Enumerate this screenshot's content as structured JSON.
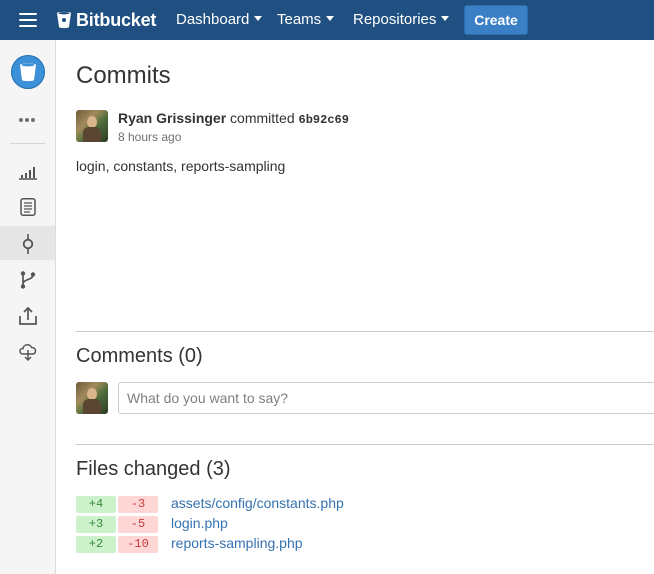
{
  "nav": {
    "brand": "Bitbucket",
    "dashboard": "Dashboard",
    "teams": "Teams",
    "repositories": "Repositories",
    "create": "Create"
  },
  "sidebar": {
    "icons": [
      "repo-avatar-icon",
      "more-icon",
      "stats-icon",
      "source-icon",
      "commits-icon",
      "branches-icon",
      "pull-requests-icon",
      "downloads-icon"
    ]
  },
  "page": {
    "title": "Commits"
  },
  "commit": {
    "author": "Ryan Grissinger",
    "verb": "committed",
    "hash": "6b92c69",
    "time": "8 hours ago",
    "message": "login, constants, reports-sampling"
  },
  "comments": {
    "title": "Comments (0)",
    "placeholder": "What do you want to say?"
  },
  "files": {
    "title": "Files changed (3)",
    "items": [
      {
        "added": "+4",
        "removed": "-3",
        "path": "assets/config/constants.php"
      },
      {
        "added": "+3",
        "removed": "-5",
        "path": "login.php"
      },
      {
        "added": "+2",
        "removed": "-10",
        "path": "reports-sampling.php"
      }
    ]
  },
  "colors": {
    "nav_bg": "#205081",
    "create_button": "#3b7fc4",
    "link": "#3572b0",
    "added_bg": "#ccf2cc",
    "removed_bg": "#ffd6d6"
  }
}
